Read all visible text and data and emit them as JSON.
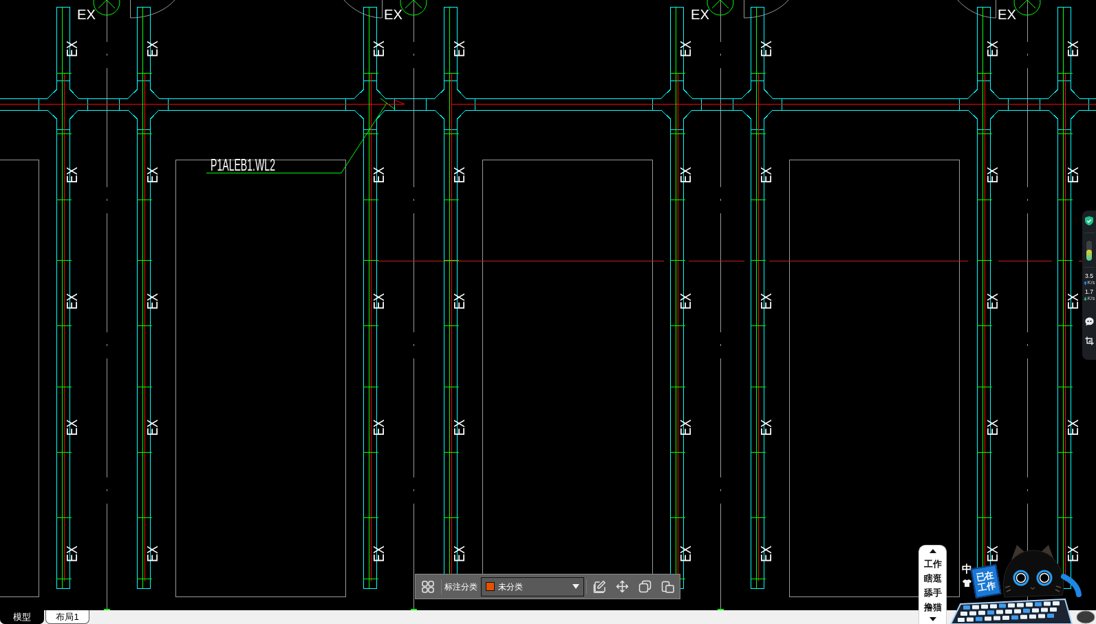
{
  "drawing": {
    "bay_labels": [
      "EX",
      "EX",
      "EX",
      "EX"
    ],
    "tag_columns": [
      {
        "tags": [
          "EX",
          "EX",
          "EX",
          "EX",
          "EX"
        ]
      },
      {
        "tags": [
          "EX",
          "EX",
          "EX",
          "EX",
          "EX"
        ]
      },
      {
        "tags": [
          "EX",
          "EX",
          "EX",
          "EX",
          "EX"
        ]
      },
      {
        "tags": [
          "EX",
          "EX",
          "EX",
          "EX",
          "EX"
        ]
      },
      {
        "tags": [
          "EX",
          "EX",
          "EX",
          "EX",
          "EX"
        ]
      },
      {
        "tags": [
          "EX",
          "EX",
          "EX",
          "EX",
          "EX"
        ]
      },
      {
        "tags": [
          "EX",
          "EX",
          "EX",
          "EX",
          "EX"
        ]
      },
      {
        "tags": [
          "EX",
          "EX",
          "EX",
          "EX",
          "EX"
        ]
      }
    ],
    "leader_label": "P1ALEB1.WL2"
  },
  "toolbar": {
    "label": "标注分类",
    "category": {
      "name": "未分类",
      "color": "#e65100"
    }
  },
  "monitor": {
    "gauge": {
      "level": 0.55
    },
    "upload": {
      "value": "3.5",
      "unit": "K/s"
    },
    "download": {
      "value": "1.7",
      "unit": "K/s"
    }
  },
  "pet": {
    "menu": [
      "工作",
      "瞎逛",
      "舔手",
      "撸猫"
    ],
    "input_mode": "中",
    "sign": "已在工作"
  },
  "tabs": [
    {
      "label": "模型",
      "selected": true
    },
    {
      "label": "布局1",
      "selected": false
    }
  ]
}
